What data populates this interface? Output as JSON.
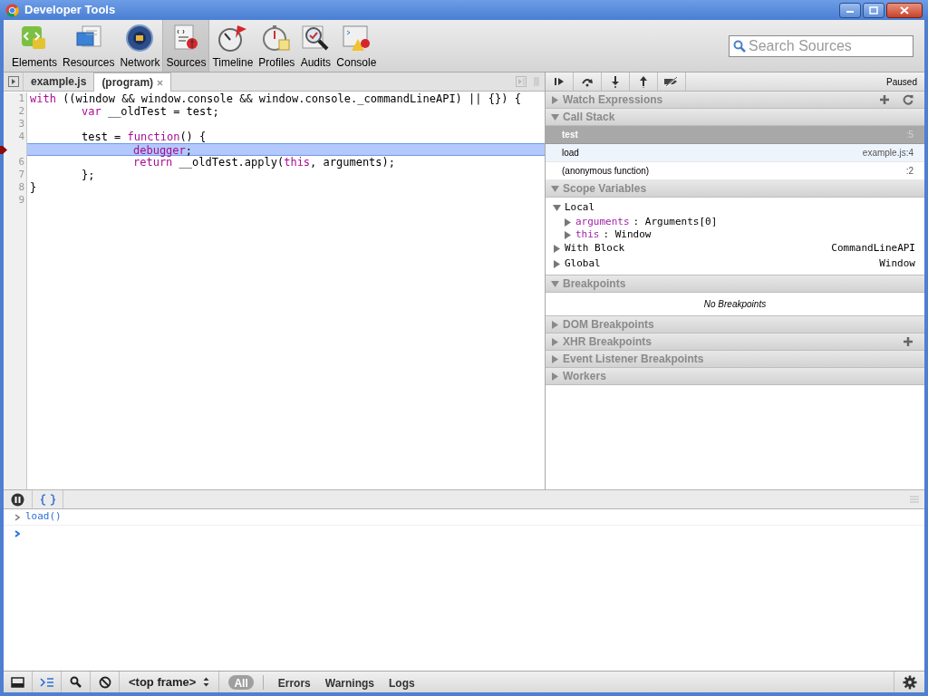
{
  "window": {
    "title": "Developer Tools"
  },
  "toolbar": {
    "tools": [
      {
        "label": "Elements",
        "selected": false
      },
      {
        "label": "Resources",
        "selected": false
      },
      {
        "label": "Network",
        "selected": false
      },
      {
        "label": "Sources",
        "selected": true
      },
      {
        "label": "Timeline",
        "selected": false
      },
      {
        "label": "Profiles",
        "selected": false
      },
      {
        "label": "Audits",
        "selected": false
      },
      {
        "label": "Console",
        "selected": false
      }
    ],
    "search": {
      "placeholder": "Search Sources"
    }
  },
  "editor": {
    "tabs": [
      {
        "label": "example.js",
        "selected": false,
        "closable": false
      },
      {
        "label": "(program)",
        "selected": true,
        "closable": true
      }
    ],
    "lines": [
      {
        "number": "1",
        "breakpoint": false,
        "current": false,
        "kind": "top",
        "segments": [
          {
            "text": "with",
            "kind": "keyword"
          },
          {
            "text": " ((window && window.console && window.console._commandLineAPI) || {}) {",
            "kind": "plain"
          }
        ]
      },
      {
        "number": "2",
        "breakpoint": false,
        "current": false,
        "kind": "nested",
        "segments": [
          {
            "text": "var",
            "kind": "keyword"
          },
          {
            "text": " __oldTest = test;",
            "kind": "plain"
          }
        ]
      },
      {
        "number": "3",
        "breakpoint": false,
        "current": false
      },
      {
        "number": "4",
        "breakpoint": false,
        "current": false,
        "kind": "nested",
        "segments": [
          {
            "text": "test = ",
            "kind": "plain"
          },
          {
            "text": "function",
            "kind": "keyword"
          },
          {
            "text": "() {",
            "kind": "plain"
          }
        ]
      },
      {
        "breakpoint": true,
        "current": true,
        "kind": "inner",
        "segments": [
          {
            "text": "debugger",
            "kind": "keyword"
          },
          {
            "text": ";",
            "kind": "plain"
          }
        ]
      },
      {
        "number": "6",
        "breakpoint": false,
        "current": false,
        "kind": "inner",
        "segments": [
          {
            "text": "return",
            "kind": "keyword"
          },
          {
            "text": " __oldTest.apply(",
            "kind": "plain"
          },
          {
            "text": "this",
            "kind": "keyword"
          },
          {
            "text": ", arguments);",
            "kind": "plain"
          }
        ]
      },
      {
        "number": "7",
        "breakpoint": false,
        "current": false,
        "kind": "nested",
        "segments": [
          {
            "text": "};",
            "kind": "plain"
          }
        ]
      },
      {
        "number": "8",
        "breakpoint": false,
        "current": false,
        "kind": "top",
        "segments": [
          {
            "text": "}",
            "kind": "plain"
          }
        ]
      },
      {
        "number": "9",
        "breakpoint": false,
        "current": false
      }
    ]
  },
  "sidebar": {
    "status": "Paused",
    "sections": [
      {
        "title": "Watch Expressions",
        "expanded": false,
        "kind": "watch"
      },
      {
        "title": "Call Stack",
        "expanded": true,
        "kind": "frames",
        "frames": [
          {
            "name": "test",
            "location": ":5",
            "selected": true,
            "hovered": false
          },
          {
            "name": "load",
            "location": "example.js:4",
            "selected": false,
            "hovered": true
          },
          {
            "name": "(anonymous function)",
            "location": ":2",
            "selected": false,
            "hovered": false
          }
        ]
      },
      {
        "title": "Scope Variables",
        "expanded": true,
        "kind": "scope",
        "scopes": [
          {
            "name": "Local",
            "expanded": true,
            "children": [
              {
                "name": "arguments",
                "value": ": Arguments[0]",
                "expanded": false
              },
              {
                "name": "this",
                "value": ": Window",
                "expanded": false
              }
            ]
          },
          {
            "name": "With Block",
            "value": "CommandLineAPI",
            "expanded": false
          },
          {
            "name": "Global",
            "value": "Window",
            "expanded": false
          }
        ]
      },
      {
        "title": "Breakpoints",
        "expanded": true,
        "kind": "message",
        "message": "No Breakpoints"
      },
      {
        "title": "DOM Breakpoints",
        "expanded": false,
        "kind": "dom"
      },
      {
        "title": "XHR Breakpoints",
        "expanded": false,
        "kind": "xhr"
      },
      {
        "title": "Event Listener Breakpoints",
        "expanded": false,
        "kind": "events"
      },
      {
        "title": "Workers",
        "expanded": false,
        "kind": "workers"
      }
    ]
  },
  "console": {
    "entries": [
      {
        "kind": "input",
        "text": "load()"
      }
    ]
  },
  "status_bar": {
    "frame": "<top frame>",
    "filters": [
      {
        "label": "All",
        "selected": true
      },
      {
        "label": "Errors",
        "selected": false
      },
      {
        "label": "Warnings",
        "selected": false
      },
      {
        "label": "Logs",
        "selected": false
      }
    ]
  }
}
